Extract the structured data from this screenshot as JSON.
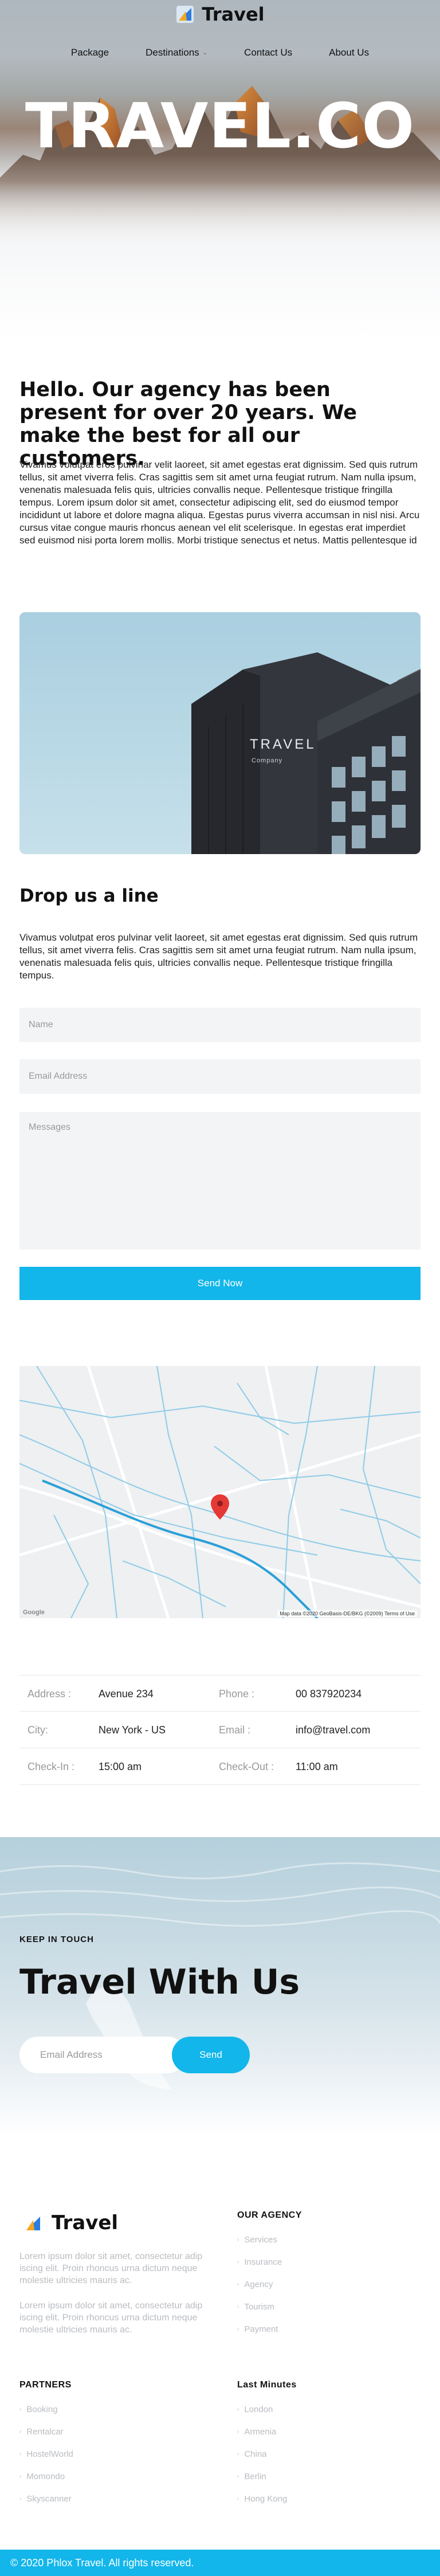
{
  "brand": {
    "name": "Travel"
  },
  "nav": {
    "items": [
      {
        "label": "Package"
      },
      {
        "label": "Destinations"
      },
      {
        "label": "Contact Us"
      },
      {
        "label": "About Us"
      }
    ]
  },
  "hero": {
    "title": "TRAVEL.CO"
  },
  "intro": {
    "heading": "Hello. Our agency has been present for over 20 years. We make the best for all our customers.",
    "body": "Vivamus volutpat eros pulvinar velit laoreet, sit amet egestas erat dignissim. Sed quis rutrum tellus, sit amet viverra felis. Cras sagittis sem sit amet urna feugiat rutrum. Nam nulla ipsum, venenatis malesuada felis quis, ultricies convallis neque. Pellentesque tristique fringilla tempus. Lorem ipsum dolor sit amet, consectetur adipiscing elit, sed do eiusmod tempor incididunt ut labore et dolore magna aliqua. Egestas purus viverra accumsan in nisl nisi. Arcu cursus vitae congue mauris rhoncus aenean vel elit scelerisque. In egestas erat imperdiet sed euismod nisi porta lorem mollis. Morbi tristique senectus et netus. Mattis pellentesque id"
  },
  "photo": {
    "sign_main": "TRAVEL",
    "sign_sub": "Company"
  },
  "contact": {
    "title": "Drop us a line",
    "body": "Vivamus volutpat eros pulvinar velit laoreet, sit amet egestas erat dignissim. Sed quis rutrum tellus, sit amet viverra felis. Cras sagittis sem sit amet urna feugiat rutrum. Nam nulla ipsum, venenatis malesuada felis quis, ultricies convallis neque. Pellentesque tristique fringilla tempus.",
    "name_placeholder": "Name",
    "email_placeholder": "Email Address",
    "message_placeholder": "Messages",
    "send_label": "Send Now"
  },
  "map": {
    "attribution": "Map data ©2020 GeoBasis-DE/BKG (©2009)   Terms of Use",
    "provider": "Google"
  },
  "info": {
    "rows": [
      {
        "l1": "Address :",
        "v1": "Avenue 234",
        "l2": "Phone :",
        "v2": "00 837920234"
      },
      {
        "l1": "City:",
        "v1": "New York - US",
        "l2": "Email :",
        "v2": "info@travel.com"
      },
      {
        "l1": "Check-In :",
        "v1": "15:00 am",
        "l2": "Check-Out :",
        "v2": "11:00 am"
      }
    ]
  },
  "newsletter": {
    "kicker": "KEEP IN TOUCH",
    "title": "Travel With Us",
    "email_placeholder": "Email Address",
    "send_label": "Send"
  },
  "footer": {
    "brand": "Travel",
    "text1": "Lorem ipsum dolor sit amet, consectetur adip iscing elit. Proin rhoncus urna dictum neque molestie ultricies mauris ac.",
    "text2": "Lorem ipsum dolor sit amet, consectetur adip iscing elit. Proin rhoncus urna dictum neque molestie ultricies mauris ac.",
    "agency_title": "OUR AGENCY",
    "agency_items": [
      "Services",
      "Insurance",
      "Agency",
      "Tourism",
      "Payment"
    ],
    "partners_title": "PARTNERS",
    "partners_items": [
      "Booking",
      "Rentalcar",
      "HostelWorld",
      "Momondo",
      "Skyscanner"
    ],
    "last_title": "Last Minutes",
    "last_items": [
      "London",
      "Armenia",
      "China",
      "Berlin",
      "Hong Kong"
    ],
    "copyright": "© 2020 Phlox Travel. All rights reserved."
  },
  "colors": {
    "accent": "#12b6ea",
    "text": "#111111",
    "muted": "#b9bcc1"
  }
}
